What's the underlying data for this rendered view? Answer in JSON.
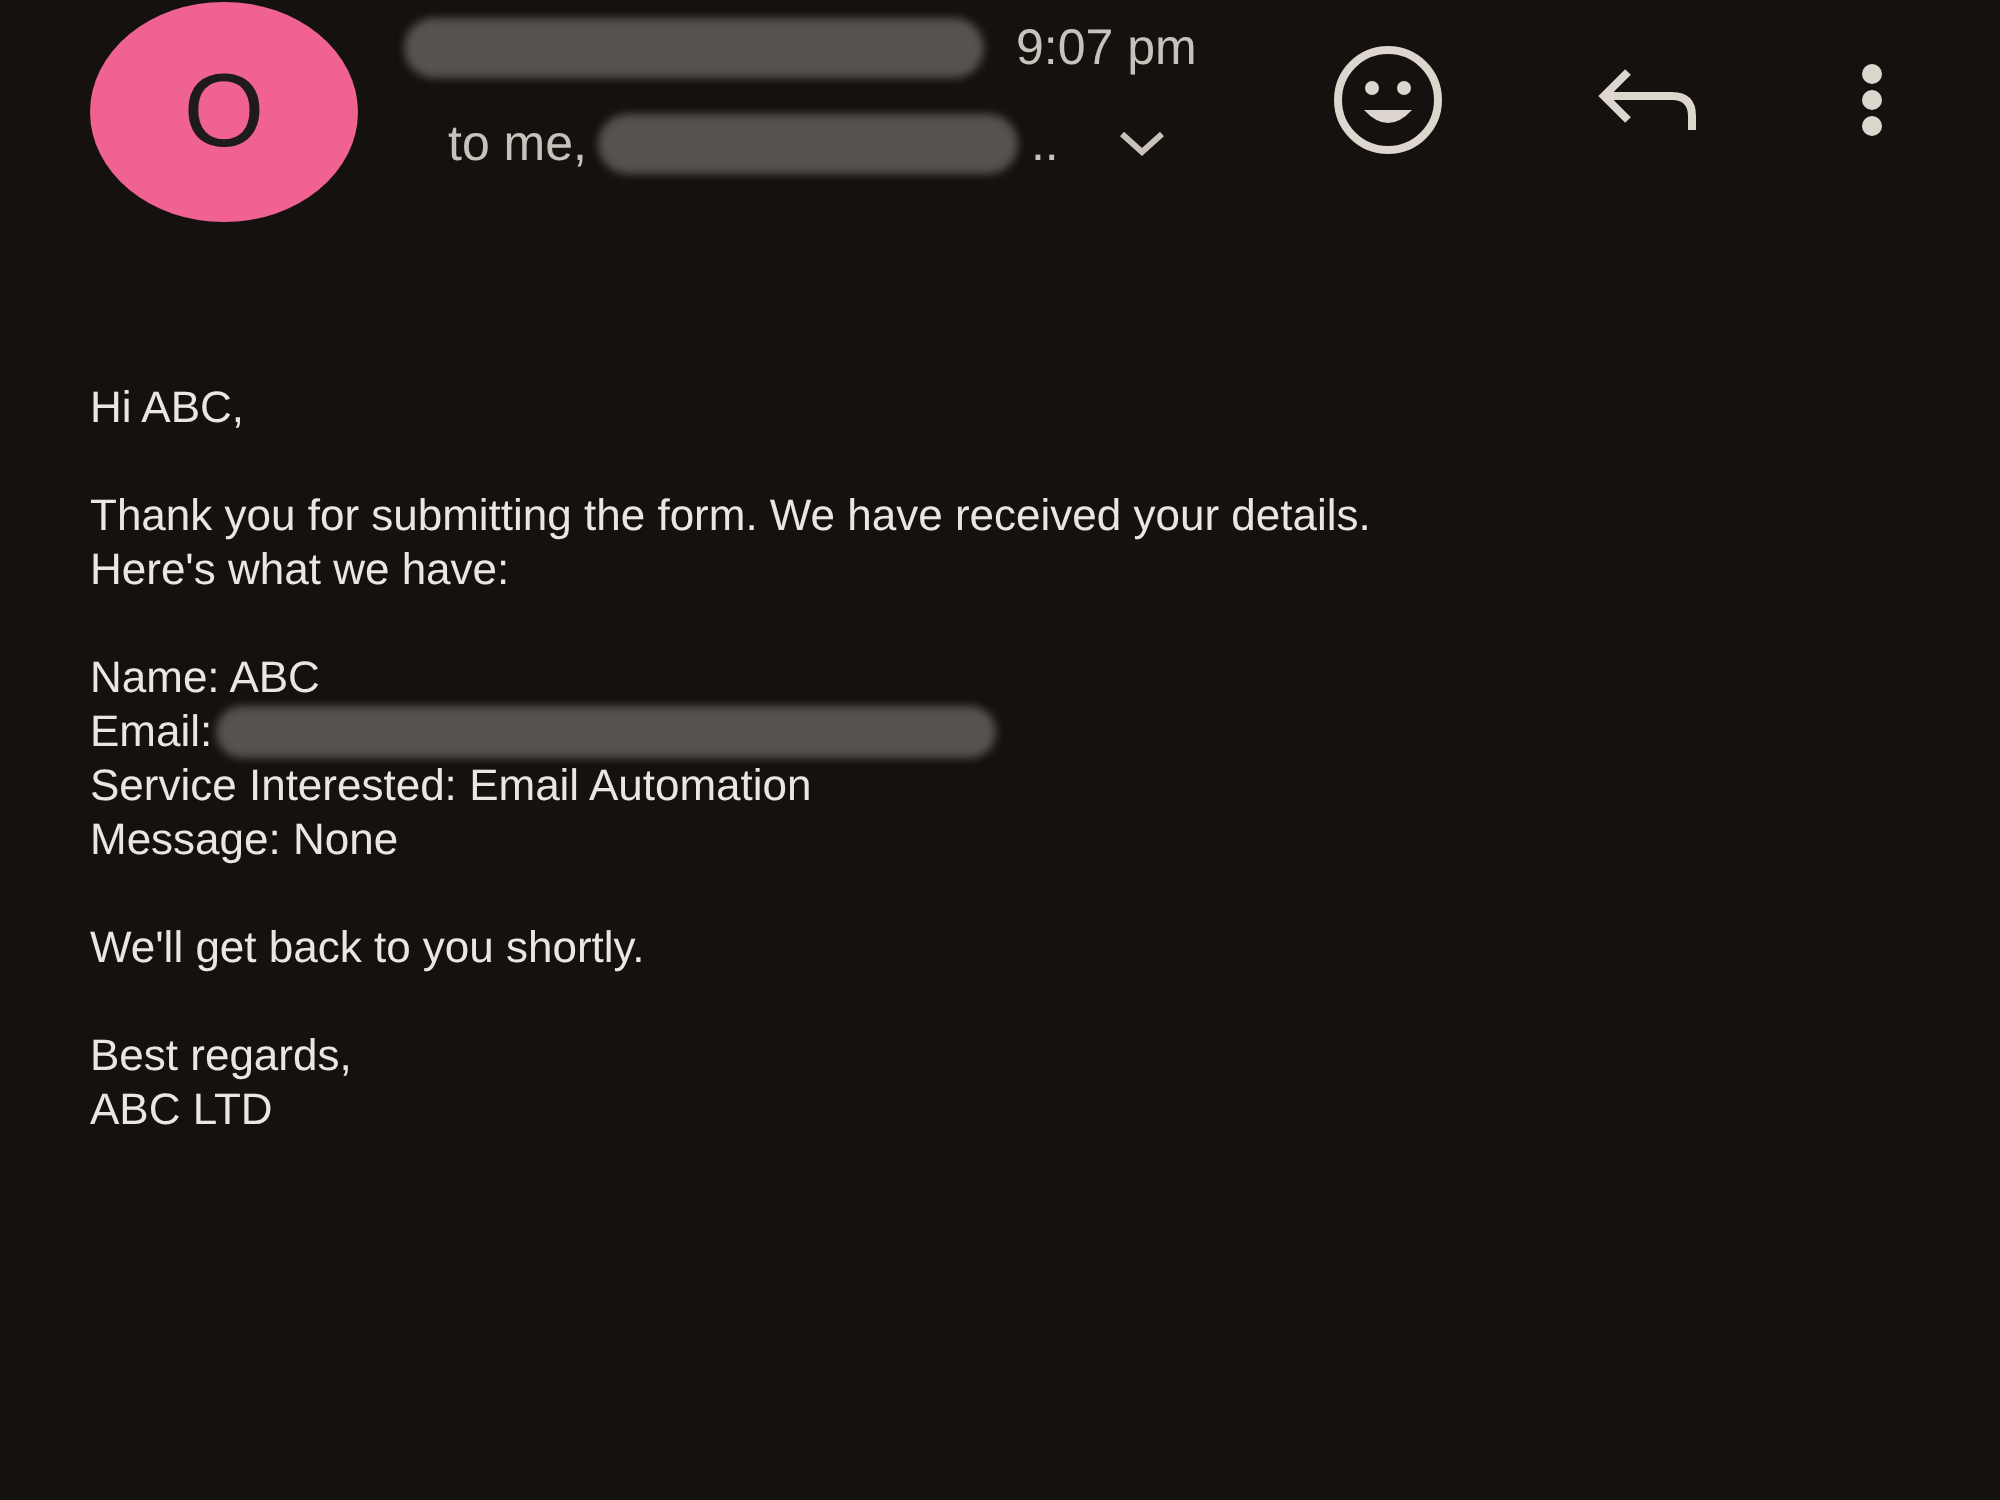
{
  "header": {
    "avatar_letter": "O",
    "time": "9:07 pm",
    "recipients_prefix": "to me,",
    "recipients_suffix": ".."
  },
  "body": {
    "greeting": "Hi ABC,",
    "intro": [
      "Thank you for submitting the form. We have received your details.",
      "Here's what we have:"
    ],
    "fields": [
      {
        "label": "Name:",
        "value": "ABC"
      },
      {
        "label": "Email:",
        "redacted": true
      },
      {
        "label": "Service Interested:",
        "value": "Email Automation"
      },
      {
        "label": "Message:",
        "value": "None"
      }
    ],
    "closing": "We'll get back to you shortly.",
    "signoff": [
      "Best regards,",
      "ABC LTD"
    ]
  }
}
